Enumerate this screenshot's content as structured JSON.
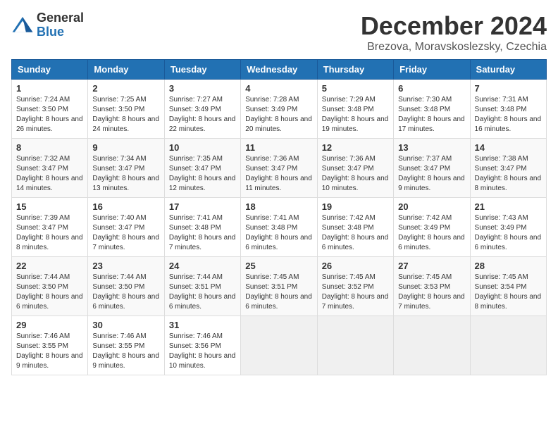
{
  "header": {
    "logo_general": "General",
    "logo_blue": "Blue",
    "title": "December 2024",
    "location": "Brezova, Moravskoslezsky, Czechia"
  },
  "days_of_week": [
    "Sunday",
    "Monday",
    "Tuesday",
    "Wednesday",
    "Thursday",
    "Friday",
    "Saturday"
  ],
  "weeks": [
    [
      {
        "day": 1,
        "sunrise": "7:24 AM",
        "sunset": "3:50 PM",
        "daylight": "8 hours and 26 minutes."
      },
      {
        "day": 2,
        "sunrise": "7:25 AM",
        "sunset": "3:50 PM",
        "daylight": "8 hours and 24 minutes."
      },
      {
        "day": 3,
        "sunrise": "7:27 AM",
        "sunset": "3:49 PM",
        "daylight": "8 hours and 22 minutes."
      },
      {
        "day": 4,
        "sunrise": "7:28 AM",
        "sunset": "3:49 PM",
        "daylight": "8 hours and 20 minutes."
      },
      {
        "day": 5,
        "sunrise": "7:29 AM",
        "sunset": "3:48 PM",
        "daylight": "8 hours and 19 minutes."
      },
      {
        "day": 6,
        "sunrise": "7:30 AM",
        "sunset": "3:48 PM",
        "daylight": "8 hours and 17 minutes."
      },
      {
        "day": 7,
        "sunrise": "7:31 AM",
        "sunset": "3:48 PM",
        "daylight": "8 hours and 16 minutes."
      }
    ],
    [
      {
        "day": 8,
        "sunrise": "7:32 AM",
        "sunset": "3:47 PM",
        "daylight": "8 hours and 14 minutes."
      },
      {
        "day": 9,
        "sunrise": "7:34 AM",
        "sunset": "3:47 PM",
        "daylight": "8 hours and 13 minutes."
      },
      {
        "day": 10,
        "sunrise": "7:35 AM",
        "sunset": "3:47 PM",
        "daylight": "8 hours and 12 minutes."
      },
      {
        "day": 11,
        "sunrise": "7:36 AM",
        "sunset": "3:47 PM",
        "daylight": "8 hours and 11 minutes."
      },
      {
        "day": 12,
        "sunrise": "7:36 AM",
        "sunset": "3:47 PM",
        "daylight": "8 hours and 10 minutes."
      },
      {
        "day": 13,
        "sunrise": "7:37 AM",
        "sunset": "3:47 PM",
        "daylight": "8 hours and 9 minutes."
      },
      {
        "day": 14,
        "sunrise": "7:38 AM",
        "sunset": "3:47 PM",
        "daylight": "8 hours and 8 minutes."
      }
    ],
    [
      {
        "day": 15,
        "sunrise": "7:39 AM",
        "sunset": "3:47 PM",
        "daylight": "8 hours and 8 minutes."
      },
      {
        "day": 16,
        "sunrise": "7:40 AM",
        "sunset": "3:47 PM",
        "daylight": "8 hours and 7 minutes."
      },
      {
        "day": 17,
        "sunrise": "7:41 AM",
        "sunset": "3:48 PM",
        "daylight": "8 hours and 7 minutes."
      },
      {
        "day": 18,
        "sunrise": "7:41 AM",
        "sunset": "3:48 PM",
        "daylight": "8 hours and 6 minutes."
      },
      {
        "day": 19,
        "sunrise": "7:42 AM",
        "sunset": "3:48 PM",
        "daylight": "8 hours and 6 minutes."
      },
      {
        "day": 20,
        "sunrise": "7:42 AM",
        "sunset": "3:49 PM",
        "daylight": "8 hours and 6 minutes."
      },
      {
        "day": 21,
        "sunrise": "7:43 AM",
        "sunset": "3:49 PM",
        "daylight": "8 hours and 6 minutes."
      }
    ],
    [
      {
        "day": 22,
        "sunrise": "7:44 AM",
        "sunset": "3:50 PM",
        "daylight": "8 hours and 6 minutes."
      },
      {
        "day": 23,
        "sunrise": "7:44 AM",
        "sunset": "3:50 PM",
        "daylight": "8 hours and 6 minutes."
      },
      {
        "day": 24,
        "sunrise": "7:44 AM",
        "sunset": "3:51 PM",
        "daylight": "8 hours and 6 minutes."
      },
      {
        "day": 25,
        "sunrise": "7:45 AM",
        "sunset": "3:51 PM",
        "daylight": "8 hours and 6 minutes."
      },
      {
        "day": 26,
        "sunrise": "7:45 AM",
        "sunset": "3:52 PM",
        "daylight": "8 hours and 7 minutes."
      },
      {
        "day": 27,
        "sunrise": "7:45 AM",
        "sunset": "3:53 PM",
        "daylight": "8 hours and 7 minutes."
      },
      {
        "day": 28,
        "sunrise": "7:45 AM",
        "sunset": "3:54 PM",
        "daylight": "8 hours and 8 minutes."
      }
    ],
    [
      {
        "day": 29,
        "sunrise": "7:46 AM",
        "sunset": "3:55 PM",
        "daylight": "8 hours and 9 minutes."
      },
      {
        "day": 30,
        "sunrise": "7:46 AM",
        "sunset": "3:55 PM",
        "daylight": "8 hours and 9 minutes."
      },
      {
        "day": 31,
        "sunrise": "7:46 AM",
        "sunset": "3:56 PM",
        "daylight": "8 hours and 10 minutes."
      },
      null,
      null,
      null,
      null
    ]
  ]
}
